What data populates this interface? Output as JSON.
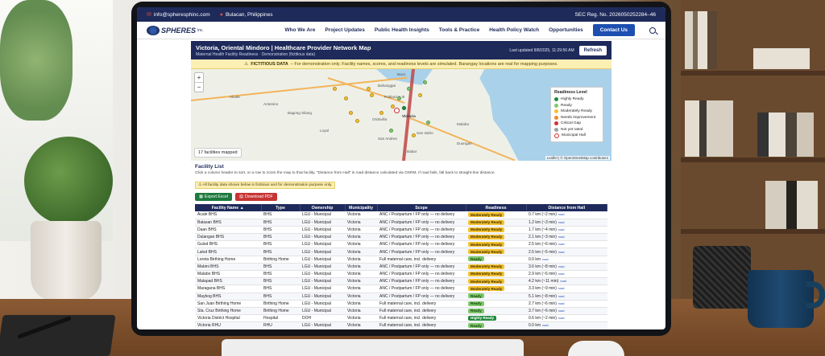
{
  "topbar": {
    "email": "info@spheresphinc.com",
    "location": "Bulacan, Philippines",
    "sec": "SEC Reg. No. 2026050252284–46"
  },
  "nav": {
    "logo": "SPHERES",
    "logo_suffix": "inc.",
    "links": [
      "Who We Are",
      "Project Updates",
      "Public Health Insights",
      "Tools & Practice",
      "Health Policy Watch",
      "Opportunities"
    ],
    "contact": "Contact Us"
  },
  "map_header": {
    "title": "Victoria, Oriental Mindoro | Healthcare Provider Network Map",
    "subtitle": "Maternal Health Facility Readiness · Demonstration (fictitious data)",
    "updated": "Last updated 8/8/2025, 11:29:56 AM",
    "refresh": "Refresh"
  },
  "warning": {
    "strong": "FICTITIOUS DATA",
    "text": "– For demonstration only. Facility names, scores, and readiness levels are simulated. Barangay locations are real for mapping purposes."
  },
  "map": {
    "zoom_in": "+",
    "zoom_out": "−",
    "mapped": "17 facilities mapped",
    "attribution": "Leaflet | © OpenStreetMap contributors",
    "places": [
      {
        "name": "Baco"
      },
      {
        "name": "Bahanggai"
      },
      {
        "name": "Alcate"
      },
      {
        "name": "Antonino"
      },
      {
        "name": "Poblacion III"
      },
      {
        "name": "Bagong Silang"
      },
      {
        "name": "Ordovilla"
      },
      {
        "name": "Victoria"
      },
      {
        "name": "Loyal"
      },
      {
        "name": "San Isidro"
      },
      {
        "name": "Malabo"
      },
      {
        "name": "San Andres"
      },
      {
        "name": "Duongan"
      },
      {
        "name": "Babar"
      }
    ],
    "legend": {
      "title": "Readiness Level",
      "items": [
        {
          "label": "Highly Ready",
          "color": "#1f8a3b"
        },
        {
          "label": "Ready",
          "color": "#7ec96a"
        },
        {
          "label": "Moderately Ready",
          "color": "#f5c12e"
        },
        {
          "label": "Needs Improvement",
          "color": "#f08a24"
        },
        {
          "label": "Critical Gap",
          "color": "#d43030"
        },
        {
          "label": "Not yet rated",
          "color": "#9aa0a6"
        },
        {
          "label": "Municipal Hall",
          "color": "hall"
        }
      ]
    }
  },
  "facility_list": {
    "title": "Facility List",
    "help": "Click a column header to sort, or a row to zoom the map to that facility. \"Distance from Hall\" is road distance calculated via OSRM. If road fails, fall back to straight-line distance.",
    "note": "All facility data shown below is fictitious and for demonstration purpose only.",
    "export_excel": "Export Excel",
    "download_pdf": "Download PDF",
    "columns": [
      "Facility Name ▲",
      "Type",
      "Ownership",
      "Municipality",
      "Scope",
      "Readiness",
      "Distance from Hall"
    ],
    "rows": [
      [
        "Acale BHS",
        "BHS",
        "LGU - Municipal",
        "Victoria",
        "ANC / Postpartum / FP only — no delivery",
        "Moderately Ready",
        "0.7 km (~2 min)",
        "road"
      ],
      [
        "Balasan BHS",
        "BHS",
        "LGU - Municipal",
        "Victoria",
        "ANC / Postpartum / FP only — no delivery",
        "Moderately Ready",
        "1.2 km (~3 min)",
        "road"
      ],
      [
        "Daan BHS",
        "BHS",
        "LGU - Municipal",
        "Victoria",
        "ANC / Postpartum / FP only — no delivery",
        "Moderately Ready",
        "1.7 km (~4 min)",
        "road"
      ],
      [
        "Dulangan BHS",
        "BHS",
        "LGU - Municipal",
        "Victoria",
        "ANC / Postpartum / FP only — no delivery",
        "Moderately Ready",
        "2.1 km (~3 min)",
        "road"
      ],
      [
        "Gulod BHS",
        "BHS",
        "LGU - Municipal",
        "Victoria",
        "ANC / Postpartum / FP only — no delivery",
        "Moderately Ready",
        "2.5 km (~6 min)",
        "road"
      ],
      [
        "Lalod BHS",
        "BHS",
        "LGU - Municipal",
        "Victoria",
        "ANC / Postpartum / FP only — no delivery",
        "Moderately Ready",
        "2.5 km (~5 min)",
        "road"
      ],
      [
        "Loreta Birthing Home",
        "Birthing Home",
        "LGU - Municipal",
        "Victoria",
        "Full maternal care, incl. delivery",
        "Ready",
        "0.0 km",
        "road"
      ],
      [
        "Mabini BHS",
        "BHS",
        "LGU - Municipal",
        "Victoria",
        "ANC / Postpartum / FP only — no delivery",
        "Moderately Ready",
        "3.6 km (~8 min)",
        "road"
      ],
      [
        "Malabo BHS",
        "BHS",
        "LGU - Municipal",
        "Victoria",
        "ANC / Postpartum / FP only — no delivery",
        "Moderately Ready",
        "2.9 km (~6 min)",
        "road"
      ],
      [
        "Malapad BHS",
        "BHS",
        "LGU - Municipal",
        "Victoria",
        "ANC / Postpartum / FP only — no delivery",
        "Moderately Ready",
        "4.2 km (~11 min)",
        "road"
      ],
      [
        "Maragana BHS",
        "BHS",
        "LGU - Municipal",
        "Victoria",
        "ANC / Postpartum / FP only — no delivery",
        "Moderately Ready",
        "3.3 km (~9 min)",
        "road"
      ],
      [
        "Maybog BHS",
        "BHS",
        "LGU - Municipal",
        "Victoria",
        "ANC / Postpartum / FP only — no delivery",
        "Ready",
        "5.1 km (~8 min)",
        "road"
      ],
      [
        "San Juan Birthing Home",
        "Birthing Home",
        "LGU - Municipal",
        "Victoria",
        "Full maternal care, incl. delivery",
        "Ready",
        "2.7 km (~6 min)",
        "road"
      ],
      [
        "Sta. Cruz Birthing Home",
        "Birthing Home",
        "LGU - Municipal",
        "Victoria",
        "Full maternal care, incl. delivery",
        "Ready",
        "3.7 km (~6 min)",
        "road"
      ],
      [
        "Victoria District Hospital",
        "Hospital",
        "DOH",
        "Victoria",
        "Full maternal care, incl. delivery",
        "Highly Ready",
        "0.6 km (~2 min)",
        "road"
      ],
      [
        "Victoria RHU",
        "RHU",
        "LGU - Municipal",
        "Victoria",
        "Full maternal care, incl. delivery",
        "Ready",
        "0.0 km",
        "road"
      ]
    ]
  }
}
